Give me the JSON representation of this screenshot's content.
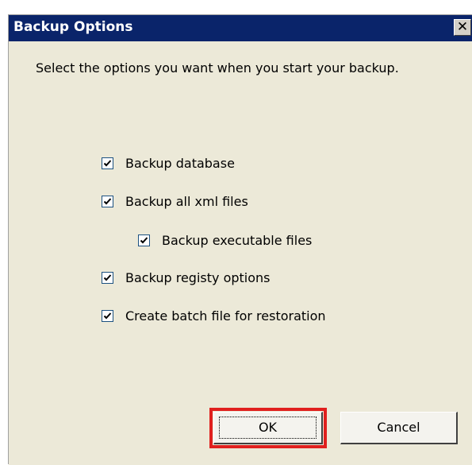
{
  "window": {
    "title": "Backup Options",
    "close_label": "✕"
  },
  "instructions": "Select the options you want when you start your backup.",
  "options": [
    {
      "label": "Backup database",
      "checked": true
    },
    {
      "label": "Backup all xml files",
      "checked": true
    },
    {
      "label": "Backup executable files",
      "checked": true
    },
    {
      "label": "Backup registy options",
      "checked": true
    },
    {
      "label": "Create batch file for restoration",
      "checked": true
    }
  ],
  "buttons": {
    "ok_label": "OK",
    "cancel_label": "Cancel"
  },
  "colors": {
    "titlebar": "#0a246a",
    "dialog_background": "#ece9d8",
    "highlight": "#e0201e"
  }
}
